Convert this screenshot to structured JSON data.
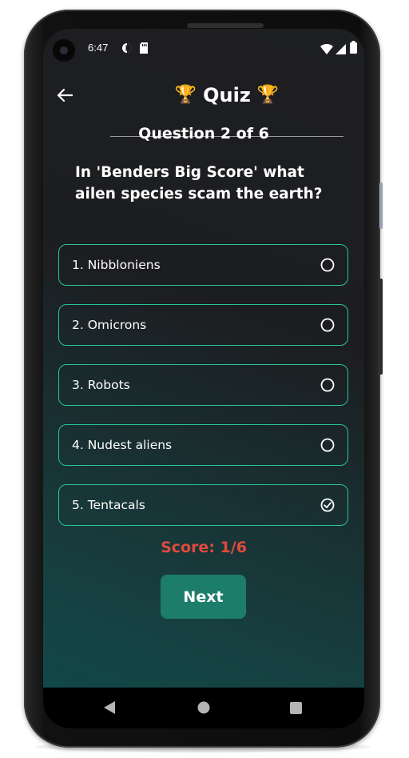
{
  "statusbar": {
    "time": "6:47",
    "icons": [
      "camera-hole",
      "data-saver-icon",
      "sd-card-icon",
      "wifi-icon",
      "signal-icon",
      "battery-icon"
    ]
  },
  "appbar": {
    "back_icon": "arrow-left-icon",
    "title": "Quiz",
    "title_prefix_emoji": "🏆",
    "title_suffix_emoji": "🏆"
  },
  "quiz": {
    "progress": "Question 2 of 6",
    "question": "In 'Benders Big Score' what ailen species scam the earth?",
    "options": [
      {
        "label": "1. Nibbloniens",
        "selected": false
      },
      {
        "label": "2. Omicrons",
        "selected": false
      },
      {
        "label": "3. Robots",
        "selected": false
      },
      {
        "label": "4. Nudest aliens",
        "selected": false
      },
      {
        "label": "5. Tentacals",
        "selected": true
      }
    ],
    "score": "Score: 1/6",
    "next_label": "Next"
  },
  "navbar": {
    "icons": [
      "back-triangle-icon",
      "home-circle-icon",
      "recents-square-icon"
    ]
  },
  "colors": {
    "accent": "#27c49a",
    "button": "#1d7d6b",
    "score": "#e24a3e",
    "background_top": "#1e1f22",
    "background_bottom": "#0f4b4a"
  }
}
